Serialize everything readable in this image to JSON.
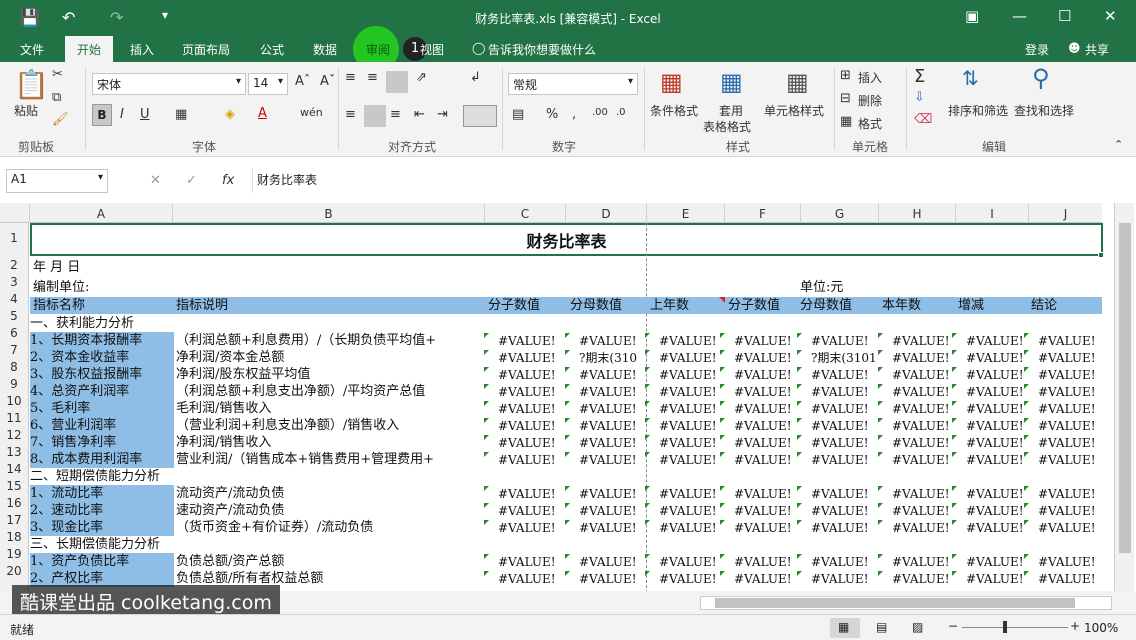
{
  "window": {
    "title": "财务比率表.xls  [兼容模式] - Excel"
  },
  "tabs": [
    "文件",
    "开始",
    "插入",
    "页面布局",
    "公式",
    "数据",
    "审阅",
    "视图"
  ],
  "tell_me": "告诉我你想要做什么",
  "login": "登录",
  "share": "共享",
  "ribbon": {
    "paste": "粘贴",
    "font_name": "宋体",
    "font_size": "14",
    "number_format": "常规",
    "cond_format": "条件格式",
    "table_format": "套用\n表格格式",
    "table_format_1": "套用",
    "table_format_2": "表格格式",
    "cell_style": "单元格样式",
    "insert": "插入",
    "delete": "删除",
    "format": "格式",
    "sort_filter": "排序和筛选",
    "find_select": "查找和选择",
    "groups": {
      "clipboard": "剪贴板",
      "font": "字体",
      "align": "对齐方式",
      "number": "数字",
      "styles": "样式",
      "cells": "单元格",
      "editing": "编辑"
    }
  },
  "formula_bar": {
    "name_box": "A1",
    "content": "财务比率表"
  },
  "columns": [
    "A",
    "B",
    "C",
    "D",
    "E",
    "F",
    "G",
    "H",
    "I",
    "J"
  ],
  "sheet": {
    "title": "财务比率表",
    "row2": "年   月   日",
    "row3_left": "编制单位:",
    "row3_right": "单位:元",
    "header": [
      "指标名称",
      "指标说明",
      "分子数值",
      "分母数值",
      "上年数",
      "分子数值",
      "分母数值",
      "本年数",
      "增减",
      "结论"
    ],
    "rows": [
      {
        "n": "5",
        "a": "一、获利能力分析",
        "hl": false,
        "b": "",
        "vals": false
      },
      {
        "n": "6",
        "a": "1、长期资本报酬率",
        "hl": true,
        "b": "（利润总额+利息费用）/（长期负债平均值+",
        "vals": true
      },
      {
        "n": "7",
        "a": "2、资本金收益率",
        "hl": true,
        "b": "净利润/资本金总额",
        "vals": true,
        "d": "?期末(310",
        "g": "?期末(3101"
      },
      {
        "n": "8",
        "a": "3、股东权益报酬率",
        "hl": true,
        "b": "净利润/股东权益平均值",
        "vals": true
      },
      {
        "n": "9",
        "a": "4、总资产利润率",
        "hl": true,
        "b": "（利润总额+利息支出净额）/平均资产总值",
        "vals": true
      },
      {
        "n": "10",
        "a": "5、毛利率",
        "hl": true,
        "b": "毛利润/销售收入",
        "vals": true
      },
      {
        "n": "11",
        "a": "6、营业利润率",
        "hl": true,
        "b": "（营业利润+利息支出净额）/销售收入",
        "vals": true
      },
      {
        "n": "12",
        "a": "7、销售净利率",
        "hl": true,
        "b": "净利润/销售收入",
        "vals": true
      },
      {
        "n": "13",
        "a": "8、成本费用利润率",
        "hl": true,
        "b": "营业利润/（销售成本+销售费用+管理费用+",
        "vals": true
      },
      {
        "n": "14",
        "a": "二、短期偿债能力分析",
        "hl": false,
        "b": "",
        "vals": false
      },
      {
        "n": "15",
        "a": "1、流动比率",
        "hl": true,
        "b": "流动资产/流动负债",
        "vals": true
      },
      {
        "n": "16",
        "a": "2、速动比率",
        "hl": true,
        "b": "速动资产/流动负债",
        "vals": true
      },
      {
        "n": "17",
        "a": "3、现金比率",
        "hl": true,
        "b": "（货币资金+有价证券）/流动负债",
        "vals": true
      },
      {
        "n": "18",
        "a": "三、长期偿债能力分析",
        "hl": false,
        "b": "",
        "vals": false
      },
      {
        "n": "19",
        "a": "1、资产负债比率",
        "hl": true,
        "b": "负债总额/资产总额",
        "vals": true
      },
      {
        "n": "20",
        "a": "2、产权比率",
        "hl": true,
        "b": "负债总额/所有者权益总额",
        "vals": true
      }
    ],
    "value_text": "#VALUE!"
  },
  "row_nums_top": [
    "1",
    "2",
    "3",
    "4"
  ],
  "watermark": "酷课堂出品 coolketang.com",
  "highlight_marker": "1",
  "status": {
    "ready": "就绪",
    "zoom": "100%"
  }
}
